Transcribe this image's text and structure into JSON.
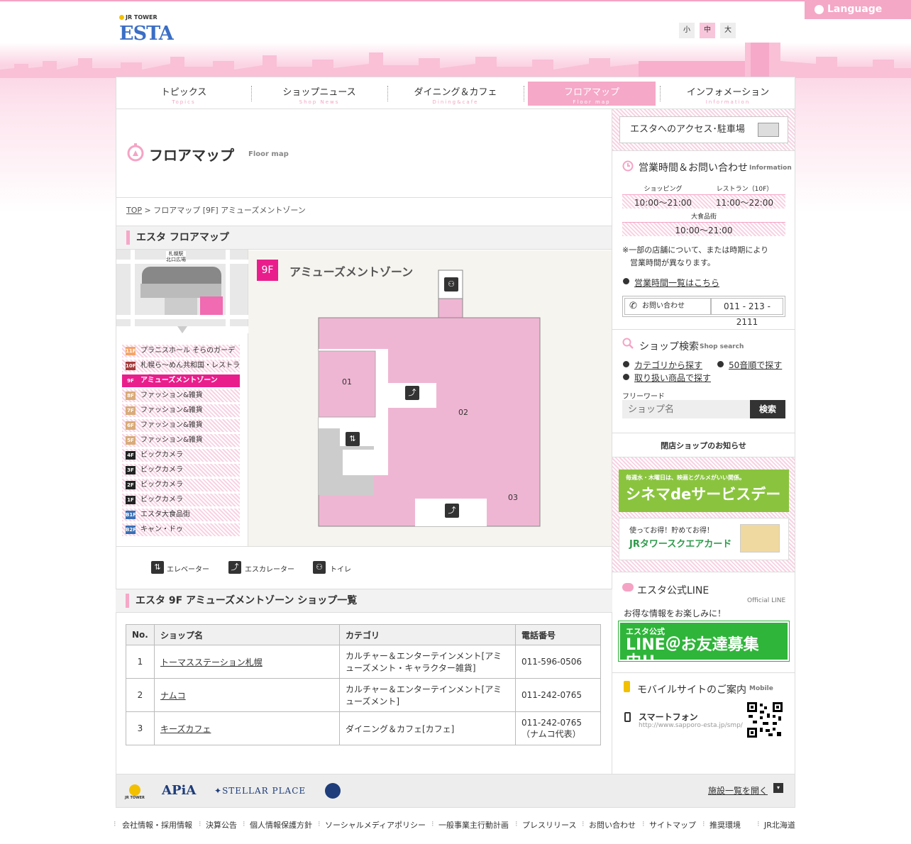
{
  "header": {
    "language_label": "Language",
    "logo_sub": "JR TOWER",
    "logo": "ESTA",
    "font_sizes": [
      "小",
      "中",
      "大"
    ]
  },
  "nav": [
    {
      "label": "トピックス",
      "sub": "Topics"
    },
    {
      "label": "ショップニュース",
      "sub": "Shop News"
    },
    {
      "label": "ダイニング＆カフェ",
      "sub": "Dining&cafe"
    },
    {
      "label": "フロアマップ",
      "sub": "Floor map"
    },
    {
      "label": "インフォメーション",
      "sub": "Information"
    }
  ],
  "page": {
    "title": "フロアマップ",
    "title_en": "Floor map",
    "breadcrumb": {
      "top": "TOP",
      "rest": "> フロアマップ [9F] アミューズメントゾーン"
    },
    "section_title": "エスタ フロアマップ",
    "minimap_label": "札幌駅\n北口広場",
    "floor_badge": "9F",
    "floor_name": "アミューズメントゾーン",
    "map_labels": [
      "01",
      "02",
      "03"
    ],
    "legend": [
      "エレベーター",
      "エスカレーター",
      "トイレ"
    ],
    "list_title": "エスタ 9F アミューズメントゾーン ショップ一覧"
  },
  "floors": [
    {
      "code": "11F",
      "name": "プラニスホール そらのガーデン",
      "color": "#f4a56a"
    },
    {
      "code": "10F",
      "name": "札幌ら～めん共和国・レストラン街",
      "color": "#a33a3a"
    },
    {
      "code": "9F",
      "name": "アミューズメントゾーン",
      "color": "#e91e8c"
    },
    {
      "code": "8F",
      "name": "ファッション&雑貨",
      "color": "#d9ab7a"
    },
    {
      "code": "7F",
      "name": "ファッション&雑貨",
      "color": "#d9ab7a"
    },
    {
      "code": "6F",
      "name": "ファッション&雑貨",
      "color": "#d9ab7a"
    },
    {
      "code": "5F",
      "name": "ファッション&雑貨",
      "color": "#d9ab7a"
    },
    {
      "code": "4F",
      "name": "ビックカメラ",
      "color": "#222"
    },
    {
      "code": "3F",
      "name": "ビックカメラ",
      "color": "#222"
    },
    {
      "code": "2F",
      "name": "ビックカメラ",
      "color": "#222"
    },
    {
      "code": "1F",
      "name": "ビックカメラ",
      "color": "#222"
    },
    {
      "code": "B1F",
      "name": "エスタ大食品街",
      "color": "#3a6fb5"
    },
    {
      "code": "B2F",
      "name": "キャン・ドゥ",
      "color": "#3a6fb5"
    }
  ],
  "table": {
    "headers": [
      "No.",
      "ショップ名",
      "カテゴリ",
      "電話番号"
    ],
    "rows": [
      {
        "no": "1",
        "name": "トーマスステーション札幌",
        "cat": "カルチャー＆エンターテインメント[アミューズメント・キャラクター雑貨]",
        "tel": "011-596-0506"
      },
      {
        "no": "2",
        "name": "ナムコ",
        "cat": "カルチャー＆エンターテインメント[アミューズメント]",
        "tel": "011-242-0765"
      },
      {
        "no": "3",
        "name": "キーズカフェ",
        "cat": "ダイニング＆カフェ[カフェ]",
        "tel": "011-242-0765 （ナムコ代表）"
      }
    ]
  },
  "side": {
    "access": "エスタへのアクセス･駐車場",
    "hours_title": "営業時間＆お問い合わせ",
    "hours_en": "Information",
    "shopping_label": "ショッピング",
    "shopping_hours": "10:00～21:00",
    "restaurant_label": "レストラン（10F）",
    "restaurant_hours": "11:00～22:00",
    "food_label": "大食品街",
    "food_hours": "10:00～21:00",
    "note": "※一部の店舗について、または時期により\n　営業時間が異なります。",
    "hours_link": "営業時間一覧はこちら",
    "contact_label": "お問い合わせ",
    "contact_tel": "011 - 213 - 2111",
    "search_title": "ショップ検索",
    "search_en": "Shop search",
    "cat_link": "カテゴリから探す",
    "kana_link": "50音順で探す",
    "goods_link": "取り扱い商品で探す",
    "freeword": "フリーワード",
    "search_placeholder": "ショップ名",
    "search_btn": "検索",
    "closing": "閉店ショップのお知らせ",
    "banner1_top": "毎週水・木曜日は、映画とグルメがいい関係。",
    "banner1_main": "シネマdeサービスデー",
    "banner2_top": "使ってお得！貯めてお得！",
    "banner2_main": "JRタワースクエアカード",
    "line_title": "エスタ公式LINE",
    "line_en": "Official LINE",
    "line_sub": "お得な情報をお楽しみに！",
    "line_banner_top": "エスタ公式",
    "line_banner_main": "LINE＠お友達募集中!!",
    "mobile_title": "モバイルサイトのご案内",
    "mobile_en": "Mobile",
    "smartphone": "スマートフォン",
    "mobile_url": "http://www.sapporo-esta.jp/smp/"
  },
  "footer": {
    "logos": [
      "JR TOWER",
      "APiA",
      "STELLAR PLACE"
    ],
    "facilities_link": "施設一覧を開く",
    "links": [
      "会社情報・採用情報",
      "決算公告",
      "個人情報保護方針",
      "ソーシャルメディアポリシー",
      "一般事業主行動計画",
      "プレスリリース",
      "お問い合わせ",
      "サイトマップ",
      "推奨環境",
      "JR北海道"
    ]
  }
}
